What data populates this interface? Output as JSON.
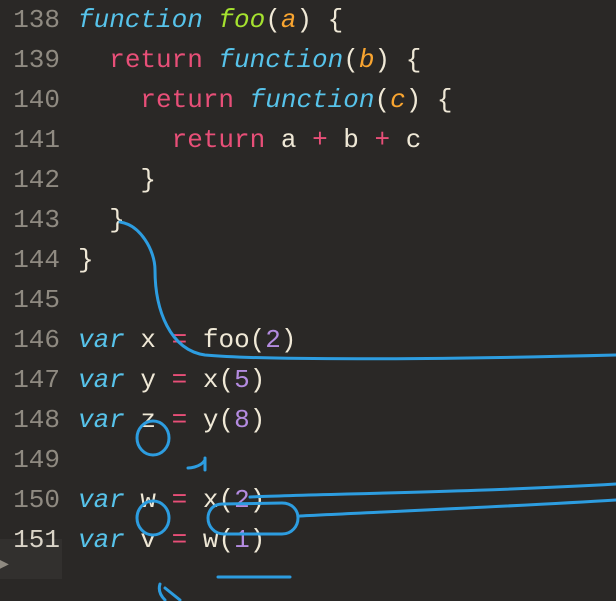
{
  "lines": [
    {
      "num": "138",
      "indent": "",
      "tokens": [
        {
          "t": "function ",
          "c": "tok-key-it"
        },
        {
          "t": "foo",
          "c": "tok-fname"
        },
        {
          "t": "(",
          "c": "tok-punc"
        },
        {
          "t": "a",
          "c": "tok-param"
        },
        {
          "t": ") {",
          "c": "tok-punc"
        }
      ]
    },
    {
      "num": "139",
      "indent": "  ",
      "tokens": [
        {
          "t": "return ",
          "c": "tok-return"
        },
        {
          "t": "function",
          "c": "tok-key-it"
        },
        {
          "t": "(",
          "c": "tok-punc"
        },
        {
          "t": "b",
          "c": "tok-param"
        },
        {
          "t": ") {",
          "c": "tok-punc"
        }
      ]
    },
    {
      "num": "140",
      "indent": "    ",
      "tokens": [
        {
          "t": "return ",
          "c": "tok-return"
        },
        {
          "t": "function",
          "c": "tok-key-it"
        },
        {
          "t": "(",
          "c": "tok-punc"
        },
        {
          "t": "c",
          "c": "tok-param"
        },
        {
          "t": ") {",
          "c": "tok-punc"
        }
      ]
    },
    {
      "num": "141",
      "indent": "      ",
      "tokens": [
        {
          "t": "return ",
          "c": "tok-return"
        },
        {
          "t": "a ",
          "c": "tok-plain"
        },
        {
          "t": "+ ",
          "c": "tok-return"
        },
        {
          "t": "b ",
          "c": "tok-plain"
        },
        {
          "t": "+ ",
          "c": "tok-return"
        },
        {
          "t": "c",
          "c": "tok-plain"
        }
      ]
    },
    {
      "num": "142",
      "indent": "    ",
      "tokens": [
        {
          "t": "}",
          "c": "tok-punc"
        }
      ]
    },
    {
      "num": "143",
      "indent": "  ",
      "tokens": [
        {
          "t": "}",
          "c": "tok-punc"
        }
      ]
    },
    {
      "num": "144",
      "indent": "",
      "tokens": [
        {
          "t": "}",
          "c": "tok-punc"
        }
      ]
    },
    {
      "num": "145",
      "indent": "",
      "tokens": []
    },
    {
      "num": "146",
      "indent": "",
      "tokens": [
        {
          "t": "var ",
          "c": "tok-key-it-v"
        },
        {
          "t": "x ",
          "c": "tok-plain"
        },
        {
          "t": "= ",
          "c": "tok-return"
        },
        {
          "t": "foo(",
          "c": "tok-plain"
        },
        {
          "t": "2",
          "c": "tok-num"
        },
        {
          "t": ")",
          "c": "tok-plain"
        }
      ]
    },
    {
      "num": "147",
      "indent": "",
      "tokens": [
        {
          "t": "var ",
          "c": "tok-key-it-v"
        },
        {
          "t": "y ",
          "c": "tok-plain"
        },
        {
          "t": "= ",
          "c": "tok-return"
        },
        {
          "t": "x(",
          "c": "tok-plain"
        },
        {
          "t": "5",
          "c": "tok-num"
        },
        {
          "t": ")",
          "c": "tok-plain"
        }
      ]
    },
    {
      "num": "148",
      "indent": "",
      "tokens": [
        {
          "t": "var ",
          "c": "tok-key-it-v"
        },
        {
          "t": "z ",
          "c": "tok-plain"
        },
        {
          "t": "= ",
          "c": "tok-return"
        },
        {
          "t": "y(",
          "c": "tok-plain"
        },
        {
          "t": "8",
          "c": "tok-num"
        },
        {
          "t": ")",
          "c": "tok-plain"
        }
      ]
    },
    {
      "num": "149",
      "indent": "",
      "tokens": []
    },
    {
      "num": "150",
      "indent": "",
      "tokens": [
        {
          "t": "var ",
          "c": "tok-key-it-v"
        },
        {
          "t": "w ",
          "c": "tok-plain"
        },
        {
          "t": "= ",
          "c": "tok-return"
        },
        {
          "t": "x(",
          "c": "tok-plain"
        },
        {
          "t": "2",
          "c": "tok-num"
        },
        {
          "t": ")",
          "c": "tok-plain"
        }
      ]
    },
    {
      "num": "151",
      "indent": "",
      "tokens": [
        {
          "t": "var ",
          "c": "tok-key-it-v"
        },
        {
          "t": "v ",
          "c": "tok-plain"
        },
        {
          "t": "= ",
          "c": "tok-return"
        },
        {
          "t": "w(",
          "c": "tok-plain"
        },
        {
          "t": "1",
          "c": "tok-num"
        },
        {
          "t": ")",
          "c": "tok-plain"
        }
      ]
    }
  ],
  "current_line_index": 13,
  "annotation_color": "#2d9de0"
}
